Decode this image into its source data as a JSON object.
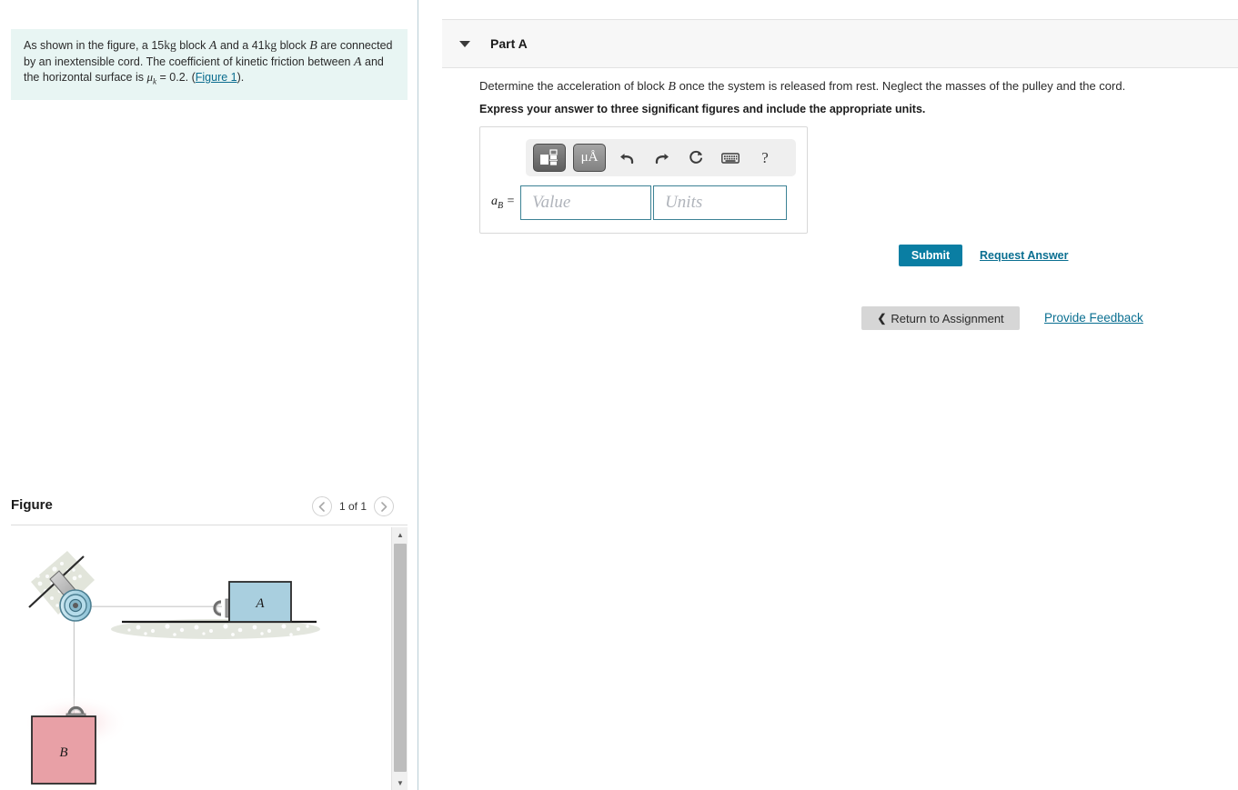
{
  "problem": {
    "text_1": "As shown in the figure, a 15",
    "unit_1": "kg",
    "text_2": " block ",
    "var_a": "A",
    "text_3": " and a 41",
    "unit_2": "kg",
    "text_4": " block ",
    "var_b": "B",
    "text_5": " are connected by an inextensible cord.  The coefficient of kinetic friction between ",
    "var_a2": "A",
    "text_6": " and the horizontal surface is ",
    "mu_symbol": "μ",
    "mu_sub": "k",
    "text_7": " = 0.2. (",
    "figure_link": "Figure 1",
    "text_8": ")."
  },
  "figure_panel": {
    "title": "Figure",
    "counter": "1 of 1",
    "prev_icon": "chevron-left-icon",
    "next_icon": "chevron-right-icon",
    "scrollbar_up_icon": "triangle-up-icon",
    "scrollbar_down_icon": "triangle-down-icon"
  },
  "figure_diagram": {
    "block_a_label": "A",
    "block_b_label": "B",
    "block_a_color": "#a9cfdf",
    "block_b_color": "#e8a0a6",
    "cord_color": "#8d8d8d",
    "pulley_color": "#9fcfe0",
    "hatch_color": "#d8dcd0",
    "ground_color": "#1a1a1a"
  },
  "part_a": {
    "caret_icon": "caret-down-icon",
    "title": "Part A",
    "question": "Determine the acceleration of block  once the system is released from rest.  Neglect the masses of the pulley and the cord.",
    "question_pre": "Determine the acceleration of block ",
    "question_var": "B",
    "question_post": " once the system is released from rest.  Neglect the masses of the pulley and the cord.",
    "instruction": "Express your answer to three significant figures and include the appropriate units."
  },
  "answer_toolbar": {
    "template_button_icon": "math-template-icon",
    "units_button_label": "μÅ",
    "units_button_icon": "units-icon",
    "undo_icon": "undo-arrow-icon",
    "redo_icon": "redo-arrow-icon",
    "reset_icon": "reset-circular-arrow-icon",
    "keyboard_icon": "keyboard-icon",
    "help_label": "?",
    "help_icon": "question-mark-icon"
  },
  "answer_input": {
    "label_var": "a",
    "label_sub": "B",
    "label_equals": " =",
    "value_placeholder": "Value",
    "units_placeholder": "Units",
    "value_current": "",
    "units_current": ""
  },
  "actions": {
    "submit_label": "Submit",
    "request_answer_label": "Request Answer",
    "return_caret_icon": "chevron-left-icon",
    "return_label": "Return to Assignment",
    "provide_feedback_label": "Provide Feedback"
  },
  "colors": {
    "accent_teal": "#0a7ea3",
    "link_teal": "#0a6f91",
    "problem_bg": "#e8f5f3",
    "panel_bg": "#f7f7f7",
    "input_border": "#3c8295"
  }
}
